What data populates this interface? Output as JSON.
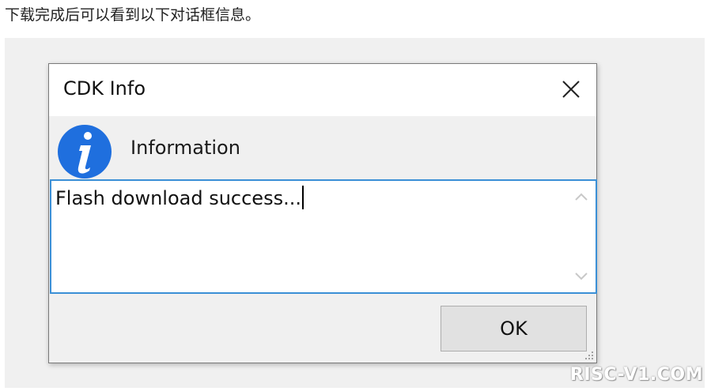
{
  "caption": "下载完成后可以看到以下对话框信息。",
  "dialog": {
    "title": "CDK Info",
    "heading": "Information",
    "message": "Flash download success...",
    "ok_label": "OK"
  },
  "icons": {
    "close": "close-icon",
    "info": "info-icon",
    "scroll_up": "chevron-up-icon",
    "scroll_down": "chevron-down-icon",
    "resize": "resize-grip-icon"
  },
  "colors": {
    "info_icon": "#1f6fde",
    "textbox_border": "#3a8fd6",
    "dialog_bg": "#f0f0f0"
  },
  "watermark": "RISC-V1.COM"
}
